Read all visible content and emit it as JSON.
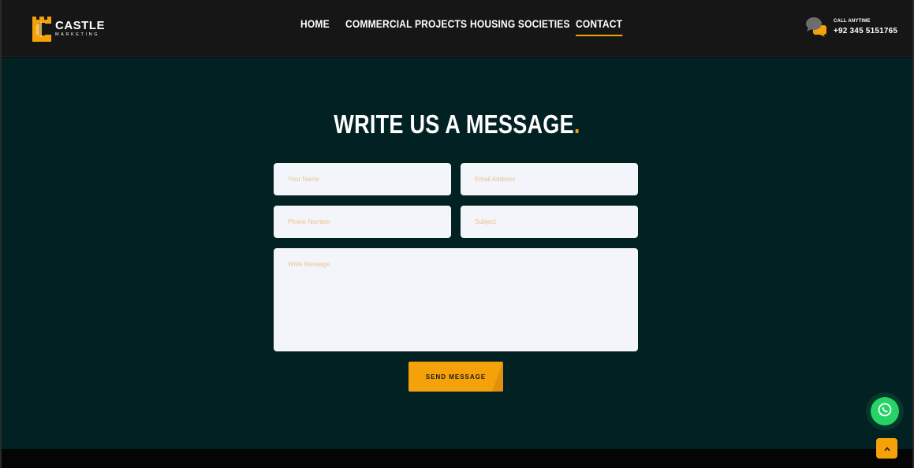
{
  "brand": {
    "name": "CASTLE",
    "tagline": "MARKETING",
    "accent_color": "#f5a20a",
    "icon": "castle-logo-icon"
  },
  "nav": {
    "items": [
      {
        "label": "HOME",
        "active": false
      },
      {
        "label": "COMMERCIAL PROJECTS",
        "active": false
      },
      {
        "label": "HOUSING SOCIETIES",
        "active": false
      },
      {
        "label": "CONTACT",
        "active": true
      }
    ]
  },
  "contact": {
    "label": "CALL ANYTIME",
    "number": "+92 345 5151765",
    "icon": "chat-bubbles-icon"
  },
  "form": {
    "title": "WRITE US A MESSAGE",
    "title_dot": ".",
    "name_placeholder": "Your Name",
    "email_placeholder": "Email Address",
    "phone_placeholder": "Phone Number",
    "subject_placeholder": "Subject",
    "message_placeholder": "Write Message",
    "submit_label": "SEND MESSAGE"
  },
  "floating": {
    "whatsapp_icon": "whatsapp-icon",
    "scroll_top_icon": "chevron-up-icon"
  },
  "colors": {
    "header_bg": "#161616",
    "section_bg": "#022123",
    "field_bg": "#f3f5fa",
    "whatsapp": "#25d366"
  }
}
